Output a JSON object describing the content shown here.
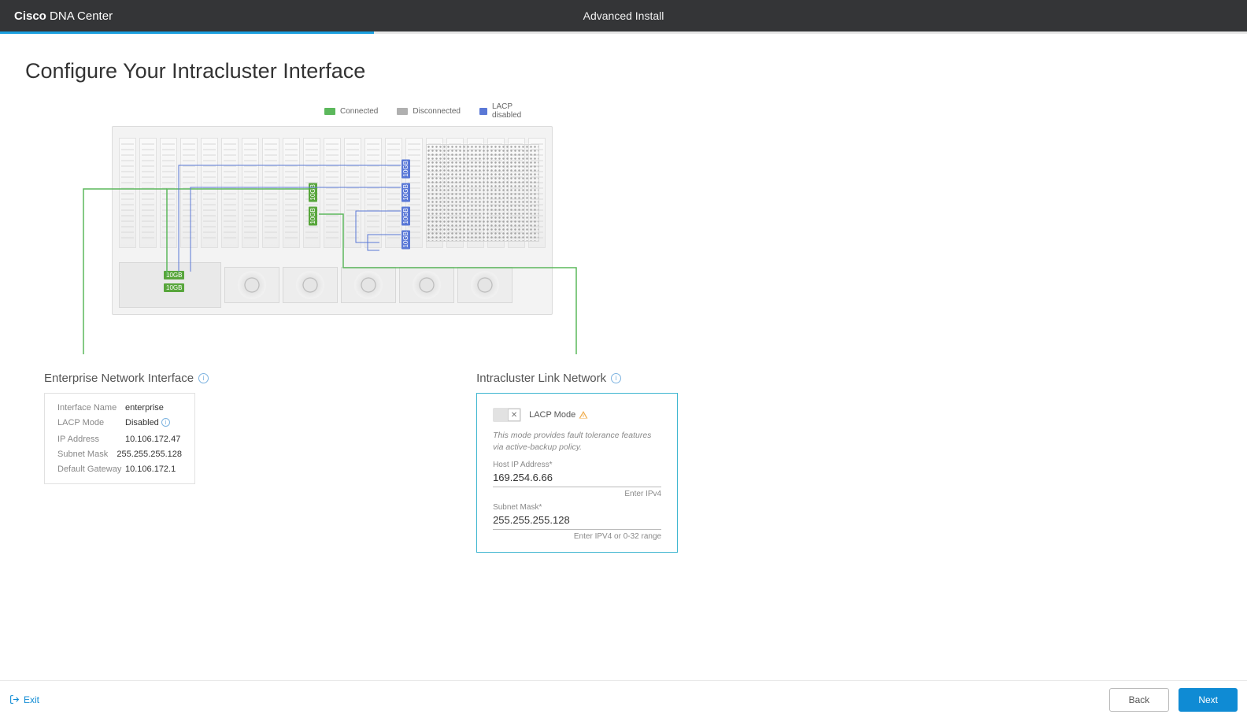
{
  "header": {
    "brand_bold": "Cisco",
    "brand_rest": " DNA Center",
    "mode": "Advanced Install",
    "progress_percent": 30
  },
  "page": {
    "title": "Configure Your Intracluster Interface"
  },
  "legend": {
    "connected": "Connected",
    "disconnected": "Disconnected",
    "lacp_disabled": "LACP disabled"
  },
  "ports": {
    "label": "10GB"
  },
  "enterprise": {
    "heading": "Enterprise Network Interface",
    "rows": [
      {
        "label": "Interface Name",
        "value": "enterprise"
      },
      {
        "label": "LACP Mode",
        "value": "Disabled"
      },
      {
        "label": "IP Address",
        "value": "10.106.172.47"
      },
      {
        "label": "Subnet Mask",
        "value": "255.255.255.128"
      },
      {
        "label": "Default Gateway",
        "value": "10.106.172.1"
      }
    ]
  },
  "intracluster": {
    "heading": "Intracluster Link Network",
    "lacp_label": "LACP Mode",
    "lacp_on": false,
    "desc": "This mode provides fault tolerance features via active-backup policy.",
    "host_ip_label": "Host IP Address*",
    "host_ip_value": "169.254.6.66",
    "host_ip_hint": "Enter IPv4",
    "subnet_label": "Subnet Mask*",
    "subnet_value": "255.255.255.128",
    "subnet_hint": "Enter IPV4 or 0-32 range"
  },
  "footer": {
    "exit": "Exit",
    "back": "Back",
    "next": "Next"
  }
}
